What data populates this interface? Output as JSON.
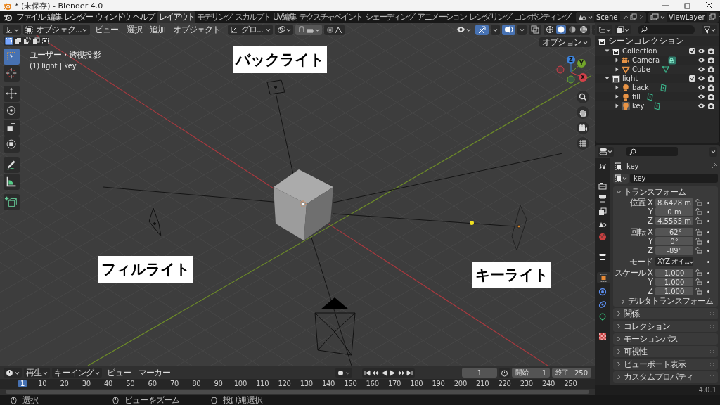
{
  "window": {
    "title": "* (未保存) - Blender 4.0"
  },
  "menu": [
    "ファイル",
    "編集",
    "レンダー",
    "ウィンドウ",
    "ヘルプ"
  ],
  "workspaces": [
    {
      "label": "レイアウト",
      "selected": true
    },
    {
      "label": "モデリング",
      "selected": false
    },
    {
      "label": "スカルプト",
      "selected": false
    },
    {
      "label": "UV編集",
      "selected": false
    },
    {
      "label": "テクスチャペイント",
      "selected": false
    },
    {
      "label": "シェーディング",
      "selected": false
    },
    {
      "label": "アニメーション",
      "selected": false
    },
    {
      "label": "レンダリング",
      "selected": false
    },
    {
      "label": "コンポジティング",
      "selected": false
    }
  ],
  "scene": "Scene",
  "view_layer": "ViewLayer",
  "viewport": {
    "mode": "オブジェク...",
    "menus": [
      "ビュー",
      "選択",
      "追加",
      "オブジェクト"
    ],
    "orientation": "グロ...",
    "options": "オプション",
    "view_name": "ユーザー・透視投影",
    "context": "(1) light | key",
    "select_modes": [
      {
        "kind": "new",
        "selected": true
      },
      {
        "kind": "extend",
        "selected": false
      },
      {
        "kind": "subtract",
        "selected": false
      },
      {
        "kind": "invert",
        "selected": false
      },
      {
        "kind": "intersect",
        "selected": false
      }
    ],
    "tools": [
      {
        "kind": "select",
        "selected": true
      },
      {
        "kind": "cursor",
        "selected": false
      },
      {
        "kind": "move",
        "selected": false
      },
      {
        "kind": "rotate",
        "selected": false
      },
      {
        "kind": "scale",
        "selected": false
      },
      {
        "kind": "transform",
        "selected": false
      },
      {
        "kind": "annotate",
        "selected": false
      },
      {
        "kind": "measure",
        "selected": false
      },
      {
        "kind": "add_cube",
        "selected": false
      }
    ],
    "shading": [
      {
        "kind": "wireframe",
        "selected": false
      },
      {
        "kind": "solid",
        "selected": true
      },
      {
        "kind": "material",
        "selected": false
      },
      {
        "kind": "rendered",
        "selected": false
      }
    ],
    "gizmo_axes": [
      "X",
      "Y",
      "Z"
    ],
    "labels": [
      "バックライト",
      "フィルライト",
      "キーライト"
    ]
  },
  "outliner": {
    "root": "シーンコレクション",
    "items": [
      {
        "name": "Collection",
        "kind": "collection",
        "expanded": true,
        "checked": true,
        "selected": false,
        "children": [
          {
            "name": "Camera",
            "kind": "camera",
            "expanded": false,
            "selected": false
          },
          {
            "name": "Cube",
            "kind": "mesh",
            "expanded": false,
            "selected": false
          }
        ]
      },
      {
        "name": "light",
        "kind": "collection",
        "expanded": true,
        "checked": true,
        "selected": true,
        "children": [
          {
            "name": "back",
            "kind": "light",
            "expanded": false,
            "selected": false
          },
          {
            "name": "fill",
            "kind": "light",
            "expanded": false,
            "selected": false
          },
          {
            "name": "key",
            "kind": "light",
            "expanded": false,
            "selected": true
          }
        ]
      }
    ]
  },
  "properties": {
    "tabs": [
      {
        "kind": "tool",
        "selected": false
      },
      {
        "kind": "render",
        "selected": false
      },
      {
        "kind": "output",
        "selected": false
      },
      {
        "kind": "view_layer",
        "selected": false
      },
      {
        "kind": "scene",
        "selected": false
      },
      {
        "kind": "world",
        "selected": false
      },
      {
        "kind": "collection",
        "selected": false
      },
      {
        "kind": "object",
        "selected": true
      },
      {
        "kind": "physics",
        "selected": false
      },
      {
        "kind": "constraints",
        "selected": false
      },
      {
        "kind": "light_data",
        "selected": false
      },
      {
        "kind": "texture",
        "selected": false
      }
    ],
    "object_name": "key",
    "datablock": "key",
    "panels": [
      {
        "label": "トランスフォーム",
        "expanded": true,
        "groups": [
          {
            "kind": "vector",
            "label": "位置",
            "rows": [
              {
                "axis": "X",
                "value": "8.6428 m"
              },
              {
                "axis": "Y",
                "value": "0 m"
              },
              {
                "axis": "Z",
                "value": "4.5565 m"
              }
            ]
          },
          {
            "kind": "vector",
            "label": "回転",
            "rows": [
              {
                "axis": "X",
                "value": "-62°"
              },
              {
                "axis": "Y",
                "value": "0°"
              },
              {
                "axis": "Z",
                "value": "-89°"
              }
            ]
          },
          {
            "kind": "dropdown",
            "label": "モード",
            "value": "XYZ オイ..."
          },
          {
            "kind": "vector",
            "label": "スケール",
            "rows": [
              {
                "axis": "X",
                "value": "1.000"
              },
              {
                "axis": "Y",
                "value": "1.000"
              },
              {
                "axis": "Z",
                "value": "1.000"
              }
            ]
          }
        ],
        "subpanel": {
          "label": "デルタトランスフォーム",
          "expanded": false
        }
      },
      {
        "label": "関係",
        "expanded": false
      },
      {
        "label": "コレクション",
        "expanded": false
      },
      {
        "label": "モーションパス",
        "expanded": false
      },
      {
        "label": "可視性",
        "expanded": false
      },
      {
        "label": "ビューポート表示",
        "expanded": false
      },
      {
        "label": "カスタムプロパティ",
        "expanded": false
      }
    ],
    "version": "4.0.1"
  },
  "timeline": {
    "menus": [
      "再生",
      "キーイング",
      "ビュー",
      "マーカー"
    ],
    "current_frame": "1",
    "start_label": "開始",
    "start": "1",
    "end_label": "終了",
    "end": "250",
    "ruler": [
      {
        "label": "1",
        "selected": true
      },
      {
        "label": "10",
        "selected": false
      },
      {
        "label": "20",
        "selected": false
      },
      {
        "label": "30",
        "selected": false
      },
      {
        "label": "40",
        "selected": false
      },
      {
        "label": "50",
        "selected": false
      },
      {
        "label": "60",
        "selected": false
      },
      {
        "label": "70",
        "selected": false
      },
      {
        "label": "80",
        "selected": false
      },
      {
        "label": "90",
        "selected": false
      },
      {
        "label": "100",
        "selected": false
      },
      {
        "label": "110",
        "selected": false
      },
      {
        "label": "120",
        "selected": false
      },
      {
        "label": "130",
        "selected": false
      },
      {
        "label": "140",
        "selected": false
      },
      {
        "label": "150",
        "selected": false
      },
      {
        "label": "160",
        "selected": false
      },
      {
        "label": "170",
        "selected": false
      },
      {
        "label": "180",
        "selected": false
      },
      {
        "label": "190",
        "selected": false
      },
      {
        "label": "200",
        "selected": false
      },
      {
        "label": "210",
        "selected": false
      },
      {
        "label": "220",
        "selected": false
      },
      {
        "label": "230",
        "selected": false
      },
      {
        "label": "240",
        "selected": false
      },
      {
        "label": "250",
        "selected": false
      }
    ]
  },
  "status_bar": [
    "選択",
    "ビューをズーム",
    "投げ縄選択"
  ]
}
